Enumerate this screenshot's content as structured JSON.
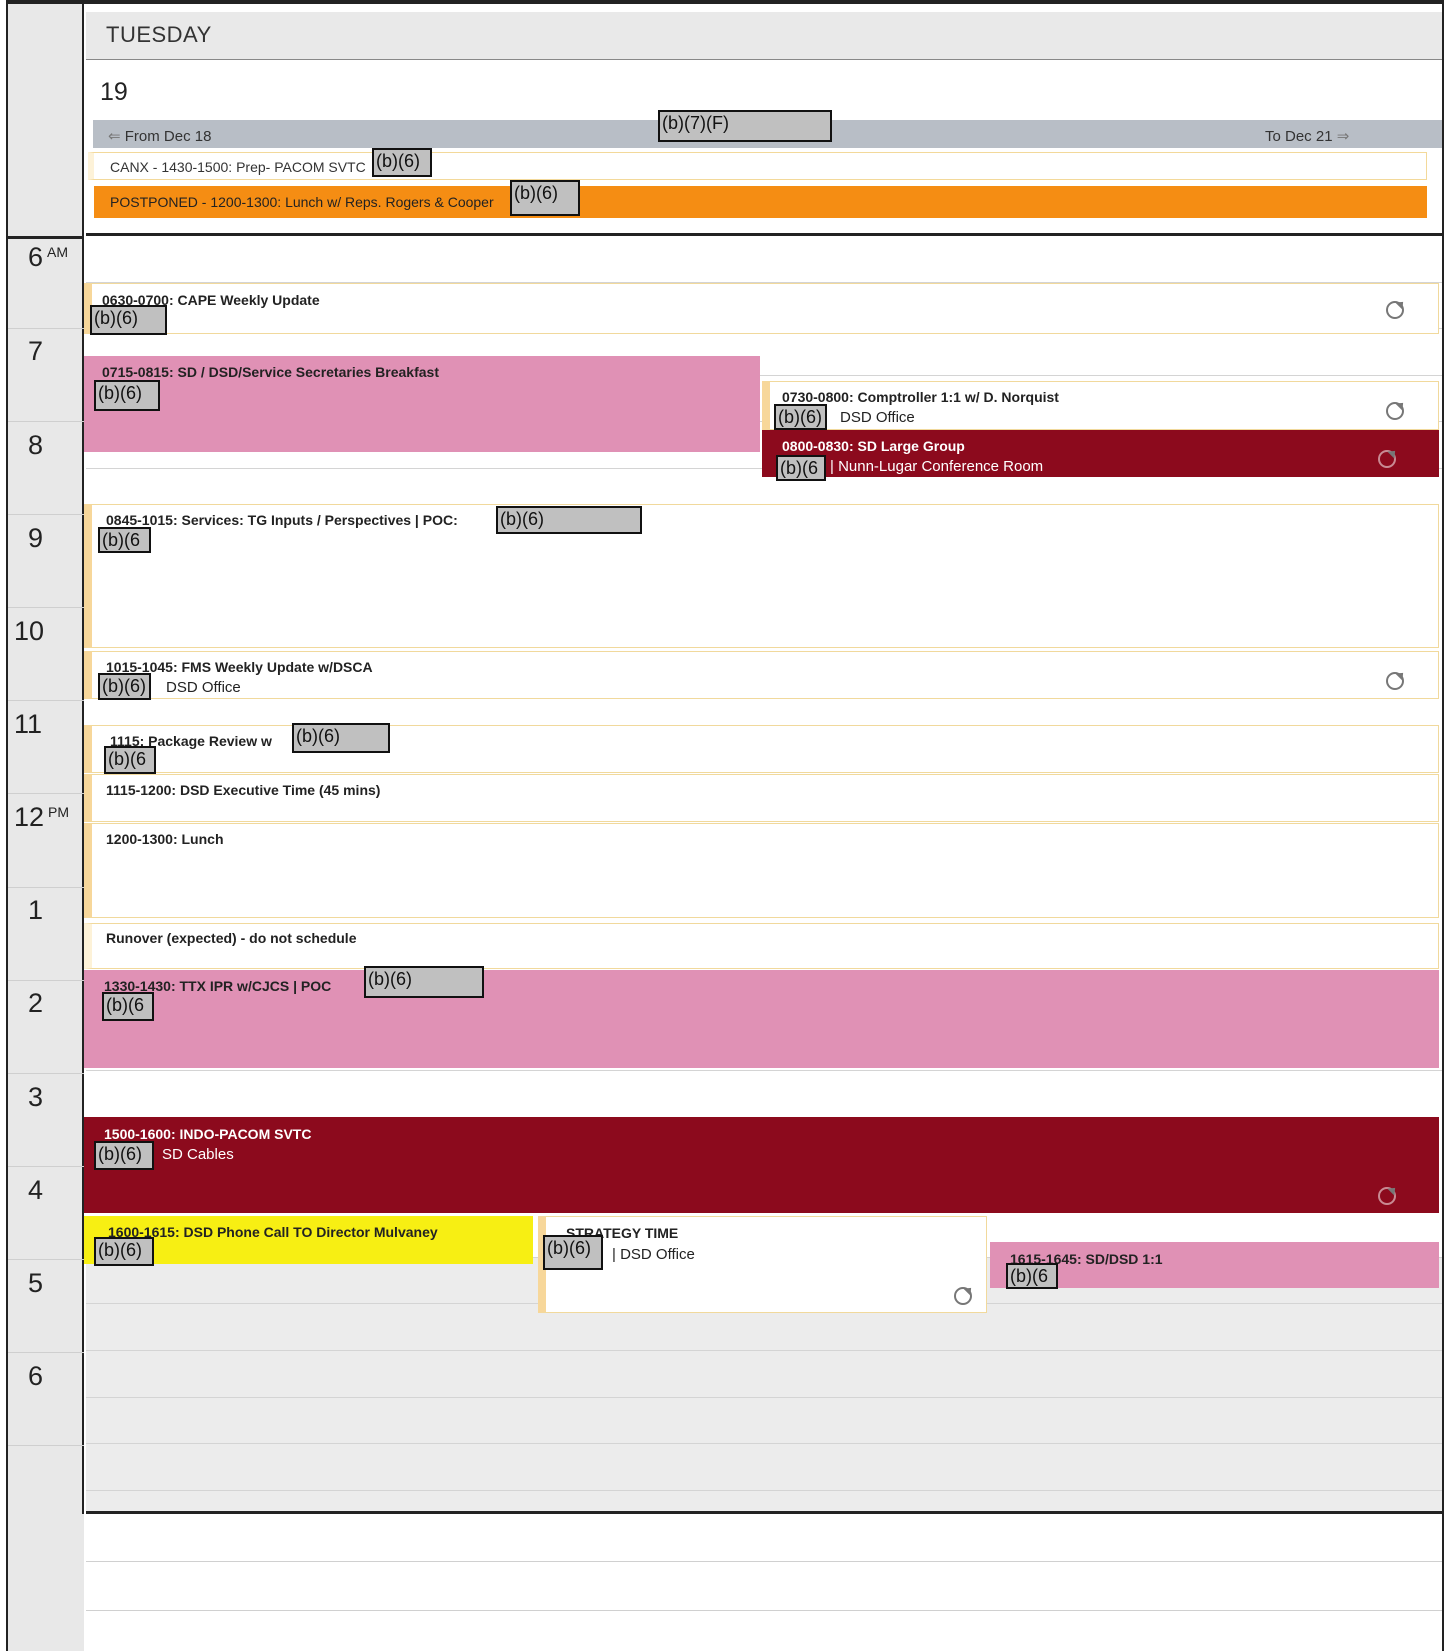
{
  "header": {
    "day_name": "TUESDAY",
    "day_number": "19",
    "nav_from": "From Dec 18",
    "nav_to": "To Dec 21",
    "nav_redaction": "(b)(7)(F)"
  },
  "all_day": [
    {
      "title": "CANX - 1430-1500: Prep- PACOM SVTC",
      "redaction": "(b)(6)"
    },
    {
      "title": "POSTPONED - 1200-1300: Lunch w/ Reps. Rogers & Cooper",
      "redaction": "(b)(6)"
    }
  ],
  "hours": [
    {
      "label": "6",
      "suffix": "AM"
    },
    {
      "label": "7",
      "suffix": ""
    },
    {
      "label": "8",
      "suffix": ""
    },
    {
      "label": "9",
      "suffix": ""
    },
    {
      "label": "10",
      "suffix": ""
    },
    {
      "label": "11",
      "suffix": ""
    },
    {
      "label": "12",
      "suffix": "PM"
    },
    {
      "label": "1",
      "suffix": ""
    },
    {
      "label": "2",
      "suffix": ""
    },
    {
      "label": "3",
      "suffix": ""
    },
    {
      "label": "4",
      "suffix": ""
    },
    {
      "label": "5",
      "suffix": ""
    },
    {
      "label": "6",
      "suffix": ""
    }
  ],
  "events": {
    "cape": {
      "title": "0630-0700: CAPE Weekly Update",
      "redaction": "(b)(6)"
    },
    "breakfast": {
      "title": "0715-0815: SD / DSD/Service Secretaries Breakfast",
      "redaction": "(b)(6)"
    },
    "comptroller": {
      "title": "0730-0800: Comptroller 1:1 w/ D. Norquist",
      "redaction": "(b)(6)",
      "location": "DSD Office"
    },
    "large_group": {
      "title": "0800-0830: SD Large Group",
      "redaction": "(b)(6",
      "location": "| Nunn-Lugar Conference Room"
    },
    "services": {
      "title": "0845-1015: Services: TG Inputs / Perspectives | POC:",
      "redaction_1": "(b)(6)",
      "redaction_2": "(b)(6"
    },
    "fms": {
      "title": "1015-1045: FMS Weekly Update w/DSCA",
      "redaction": "(b)(6)",
      "location": "DSD Office"
    },
    "package": {
      "title": "1115: Package Review w",
      "redaction_1": "(b)(6)",
      "redaction_2": "(b)(6"
    },
    "exec_time": {
      "title": "1115-1200: DSD Executive Time (45 mins)"
    },
    "lunch": {
      "title": "1200-1300: Lunch"
    },
    "runover": {
      "title": "Runover (expected) - do not schedule"
    },
    "ttx": {
      "title": "1330-1430: TTX IPR w/CJCS | POC",
      "redaction_1": "(b)(6)",
      "redaction_2": "(b)(6"
    },
    "indo": {
      "title": "1500-1600: INDO-PACOM SVTC",
      "redaction": "(b)(6)",
      "location": "SD Cables"
    },
    "phone": {
      "title": "1600-1615: DSD Phone Call TO Director Mulvaney",
      "redaction": "(b)(6)"
    },
    "strategy": {
      "title": "STRATEGY TIME",
      "redaction": "(b)(6)",
      "location": "| DSD Office"
    },
    "sd_dsd": {
      "title": "1615-1645: SD/DSD 1:1",
      "redaction": "(b)(6"
    }
  },
  "colors": {
    "orange": "#f58d13",
    "pink": "#e091b5",
    "dark_red": "#8c0a1d",
    "yellow": "#f7ef13",
    "gold_border": "#f7d79a"
  },
  "icons": [
    "sync-icon",
    "arrow-left-icon",
    "arrow-right-icon"
  ]
}
